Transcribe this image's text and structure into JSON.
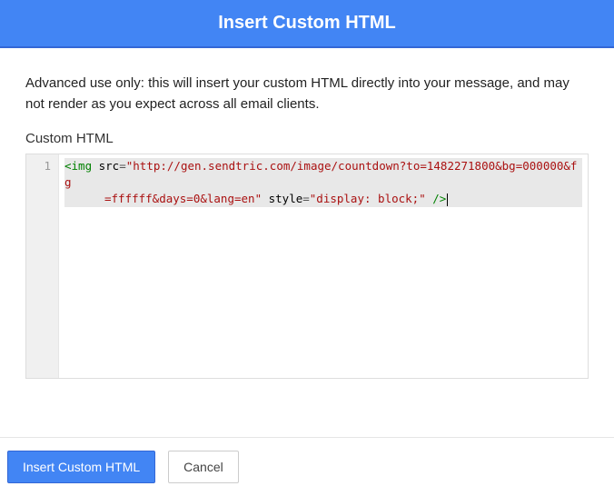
{
  "header": {
    "title": "Insert Custom HTML"
  },
  "body": {
    "description": "Advanced use only: this will insert your custom HTML directly into your message, and may not render as you expect across all email clients.",
    "field_label": "Custom HTML"
  },
  "editor": {
    "gutter": {
      "line1": "1"
    },
    "code": {
      "line1_seg1_open": "<img",
      "line1_seg2_attr": " src",
      "line1_seg3_eq": "=",
      "line1_seg4_str": "\"http://gen.sendtric.com/image/countdown?to=1482271800&bg=000000&fg",
      "line2_seg1_str": "=ffffff&days=0&lang=en\"",
      "line2_seg2_attr": " style",
      "line2_seg3_eq": "=",
      "line2_seg4_str": "\"display: block;\"",
      "line2_seg5_close": " />"
    }
  },
  "footer": {
    "insert_label": "Insert Custom HTML",
    "cancel_label": "Cancel"
  }
}
